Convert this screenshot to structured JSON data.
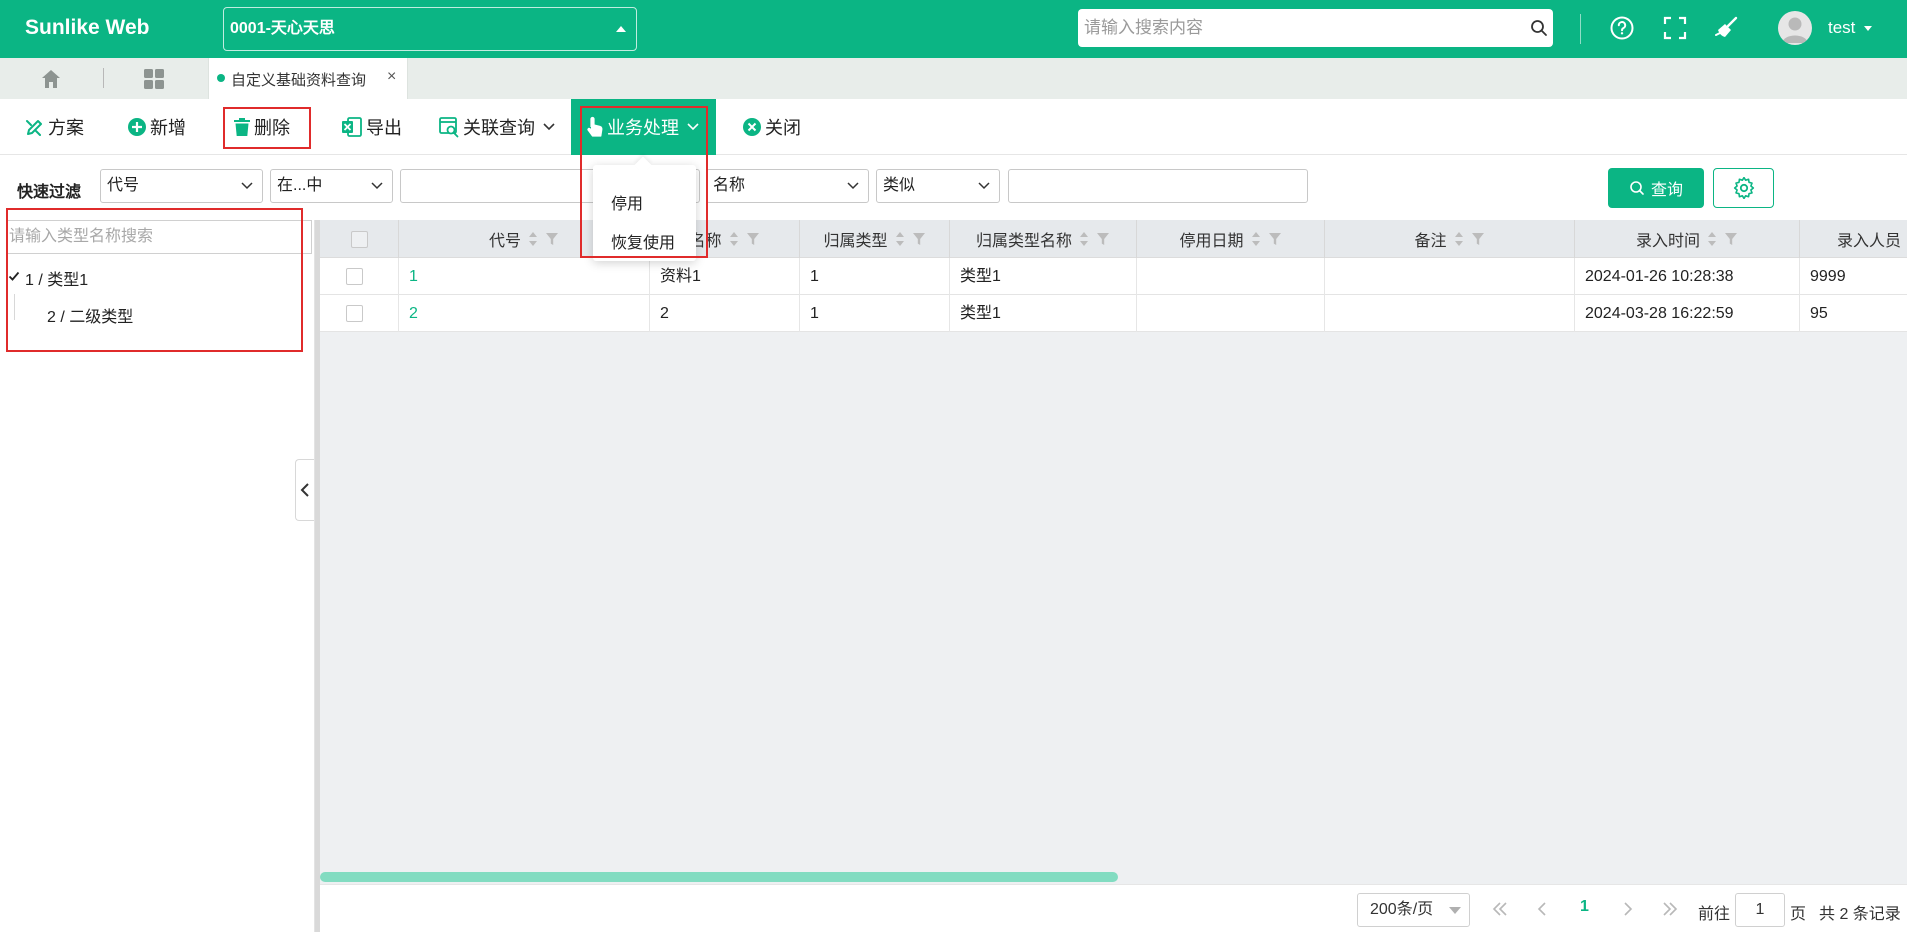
{
  "header": {
    "logo": "Sunlike Web",
    "org_selector": "0001-天心天思",
    "search_placeholder": "请输入搜索内容",
    "user": "test"
  },
  "tabs": {
    "active_tab": "自定义基础资料查询",
    "close_glyph": "×"
  },
  "toolbar": {
    "scheme": "方案",
    "add": "新增",
    "delete": "删除",
    "export": "导出",
    "related_query": "关联查询",
    "business": "业务处理",
    "close": "关闭"
  },
  "business_menu": {
    "disable": "停用",
    "restore": "恢复使用"
  },
  "filter": {
    "label": "快速过滤",
    "field1": "代号",
    "op1": "在...中",
    "field2": "名称",
    "op2": "类似",
    "query_button": "查询"
  },
  "tree": {
    "search_placeholder": "请输入类型名称搜索",
    "items": [
      {
        "label": "1 / 类型1",
        "expanded": true
      },
      {
        "label": "2 / 二级类型"
      }
    ]
  },
  "grid": {
    "columns": [
      "代号",
      "名称",
      "归属类型",
      "归属类型名称",
      "停用日期",
      "备注",
      "录入时间",
      "录入人员"
    ],
    "rows": [
      {
        "code": "1",
        "name": "资料1",
        "type": "1",
        "type_name": "类型1",
        "stop_date": "",
        "remark": "",
        "created": "2024-01-26 10:28:38",
        "creator": "9999"
      },
      {
        "code": "2",
        "name": "2",
        "type": "1",
        "type_name": "类型1",
        "stop_date": "",
        "remark": "",
        "created": "2024-03-28 16:22:59",
        "creator": "95"
      }
    ]
  },
  "pagination": {
    "page_size": "200条/页",
    "current_page": "1",
    "goto_label": "前往",
    "goto_value": "1",
    "page_unit": "页",
    "total": "共 2 条记录"
  },
  "colors": {
    "brand": "#0bb584",
    "highlight_box": "#e02b2b"
  }
}
